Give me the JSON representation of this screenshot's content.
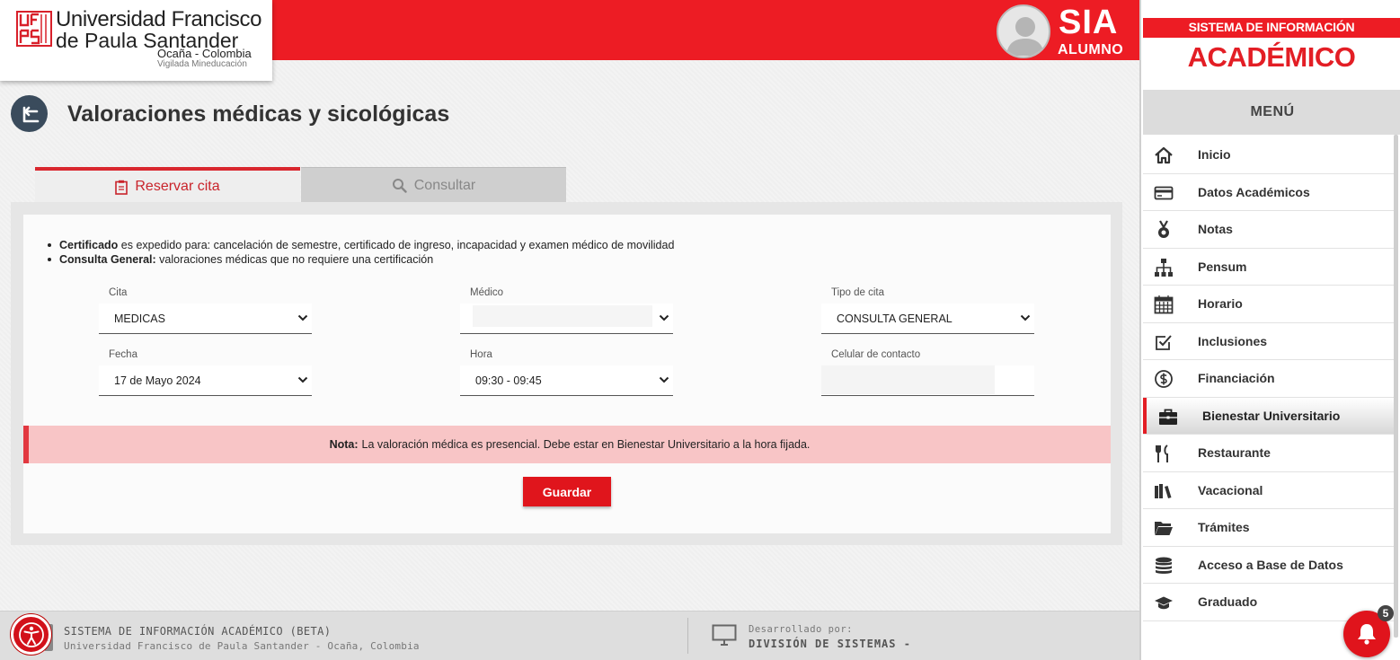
{
  "header": {
    "university_line1": "Universidad Francisco",
    "university_line2": "de Paula Santander",
    "university_line3": "Ocaña - Colombia",
    "university_line4": "Vigilada Mineducación",
    "app_name": "SIA",
    "app_role": "ALUMNO",
    "brand_color": "#ed1c24"
  },
  "page": {
    "title": "Valoraciones médicas y sicológicas"
  },
  "tabs": [
    {
      "label": "Reservar cita",
      "icon": "clipboard-icon",
      "active": true
    },
    {
      "label": "Consultar",
      "icon": "search-icon",
      "active": false
    }
  ],
  "info": {
    "items": [
      {
        "term": "Certificado",
        "text": " es expedido para: cancelación de semestre, certificado de ingreso, incapacidad y examen médico de movilidad"
      },
      {
        "term": "Consulta General:",
        "text": " valoraciones médicas que no requiere una certificación"
      }
    ]
  },
  "form": {
    "cita": {
      "label": "Cita",
      "value": "MEDICAS"
    },
    "medico": {
      "label": "Médico",
      "value": ""
    },
    "tipo_cita": {
      "label": "Tipo de cita",
      "value": "CONSULTA GENERAL"
    },
    "fecha": {
      "label": "Fecha",
      "value": "17 de Mayo 2024"
    },
    "hora": {
      "label": "Hora",
      "value": "09:30 - 09:45"
    },
    "celular": {
      "label": "Celular de contacto",
      "value": ""
    }
  },
  "note": {
    "label": "Nota:",
    "text": "La valoración médica es presencial. Debe estar en Bienestar Universitario a la hora fijada."
  },
  "actions": {
    "save_label": "Guardar"
  },
  "footer": {
    "system_name": "SISTEMA DE INFORMACIÓN ACADÉMICO (BETA)",
    "institution": "Universidad Francisco de Paula Santander - Ocaña, Colombia",
    "developed_by_label": "Desarrollado por:",
    "developer": "DIVISIÓN DE SISTEMAS -"
  },
  "sidebar": {
    "ribbon": "SISTEMA DE INFORMACIÓN",
    "title": "ACADÉMICO",
    "menu_title": "MENÚ",
    "items": [
      {
        "label": "Inicio",
        "icon": "home-icon"
      },
      {
        "label": "Datos Académicos",
        "icon": "card-icon"
      },
      {
        "label": "Notas",
        "icon": "medal-icon"
      },
      {
        "label": "Pensum",
        "icon": "sitemap-icon"
      },
      {
        "label": "Horario",
        "icon": "calendar-icon"
      },
      {
        "label": "Inclusiones",
        "icon": "checkbox-icon"
      },
      {
        "label": "Financiación",
        "icon": "dollar-icon"
      },
      {
        "label": "Bienestar Universitario",
        "icon": "briefcase-icon",
        "active": true
      },
      {
        "label": "Restaurante",
        "icon": "utensils-icon"
      },
      {
        "label": "Vacacional",
        "icon": "books-icon"
      },
      {
        "label": "Trámites",
        "icon": "folder-icon"
      },
      {
        "label": "Acceso a Base de Datos",
        "icon": "database-icon"
      },
      {
        "label": "Graduado",
        "icon": "graduation-cap-icon"
      }
    ]
  },
  "notifications": {
    "count": "5"
  }
}
